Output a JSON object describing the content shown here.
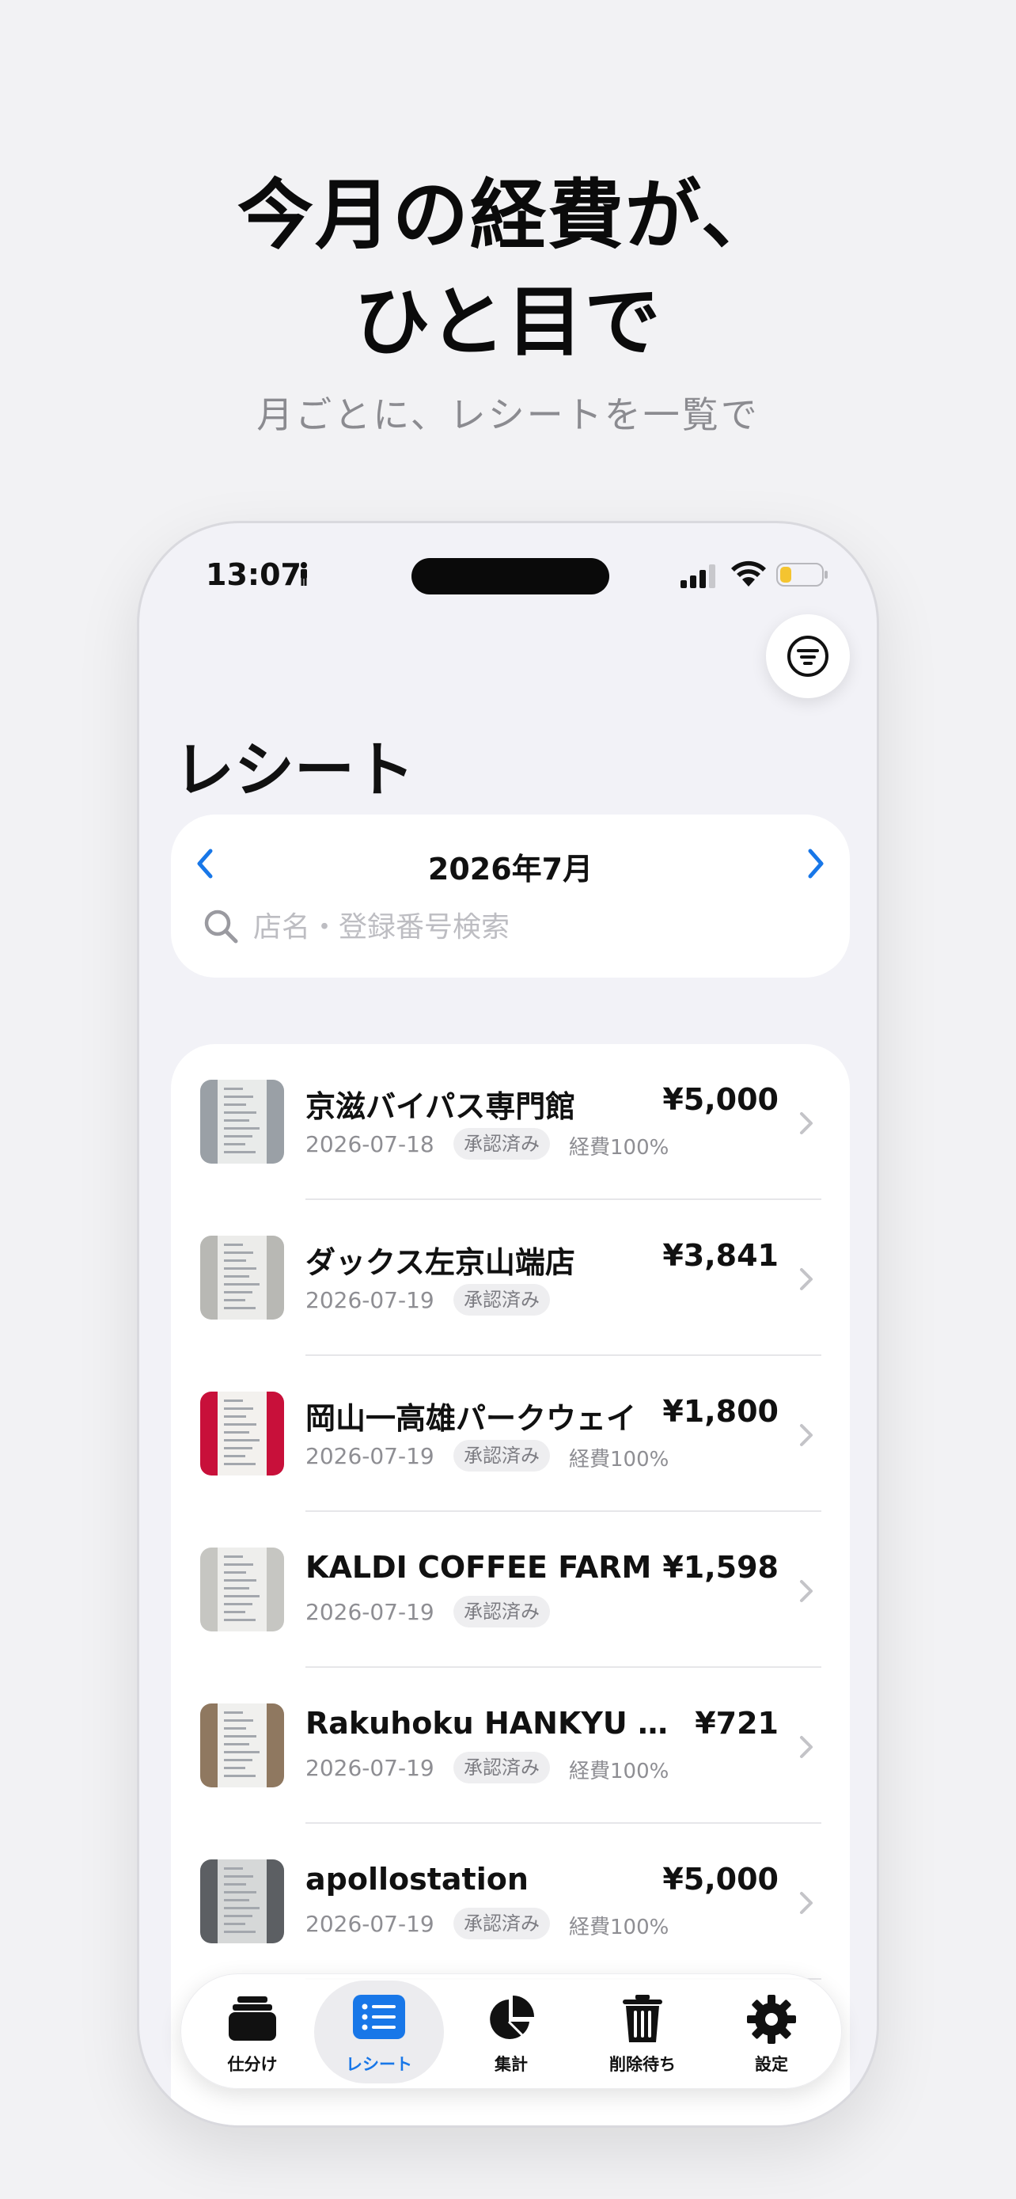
{
  "headline": {
    "line1": "今月の経費が、",
    "line2": "ひと目で",
    "sub": "月ごとに、レシートを一覧で"
  },
  "status_bar": {
    "time": "13:07"
  },
  "page": {
    "title": "レシート"
  },
  "month": {
    "label": "2026年7月"
  },
  "search": {
    "placeholder": "店名・登録番号検索"
  },
  "receipts": [
    {
      "name": "京滋バイパス専門館",
      "amount": "¥5,000",
      "date": "2026-07-18",
      "status": "承認済み",
      "ratio": "経費100%"
    },
    {
      "name": "ダックス左京山端店",
      "amount": "¥3,841",
      "date": "2026-07-19",
      "status": "承認済み",
      "ratio": ""
    },
    {
      "name": "岡山一高雄パークウェイ",
      "amount": "¥1,800",
      "date": "2026-07-19",
      "status": "承認済み",
      "ratio": "経費100%"
    },
    {
      "name": "KALDI COFFEE FARM",
      "amount": "¥1,598",
      "date": "2026-07-19",
      "status": "承認済み",
      "ratio": ""
    },
    {
      "name": "Rakuhoku HANKYU SQ...",
      "amount": "¥721",
      "date": "2026-07-19",
      "status": "承認済み",
      "ratio": "経費100%"
    },
    {
      "name": "apollostation",
      "amount": "¥5,000",
      "date": "2026-07-19",
      "status": "承認済み",
      "ratio": "経費100%"
    }
  ],
  "tabs": [
    {
      "label": "仕分け",
      "icon": "tray-stack-icon"
    },
    {
      "label": "レシート",
      "icon": "list-icon"
    },
    {
      "label": "集計",
      "icon": "pie-chart-icon"
    },
    {
      "label": "削除待ち",
      "icon": "trash-icon"
    },
    {
      "label": "設定",
      "icon": "gear-icon"
    }
  ],
  "colors": {
    "accent": "#1877e8",
    "background": "#f2f2f7"
  }
}
